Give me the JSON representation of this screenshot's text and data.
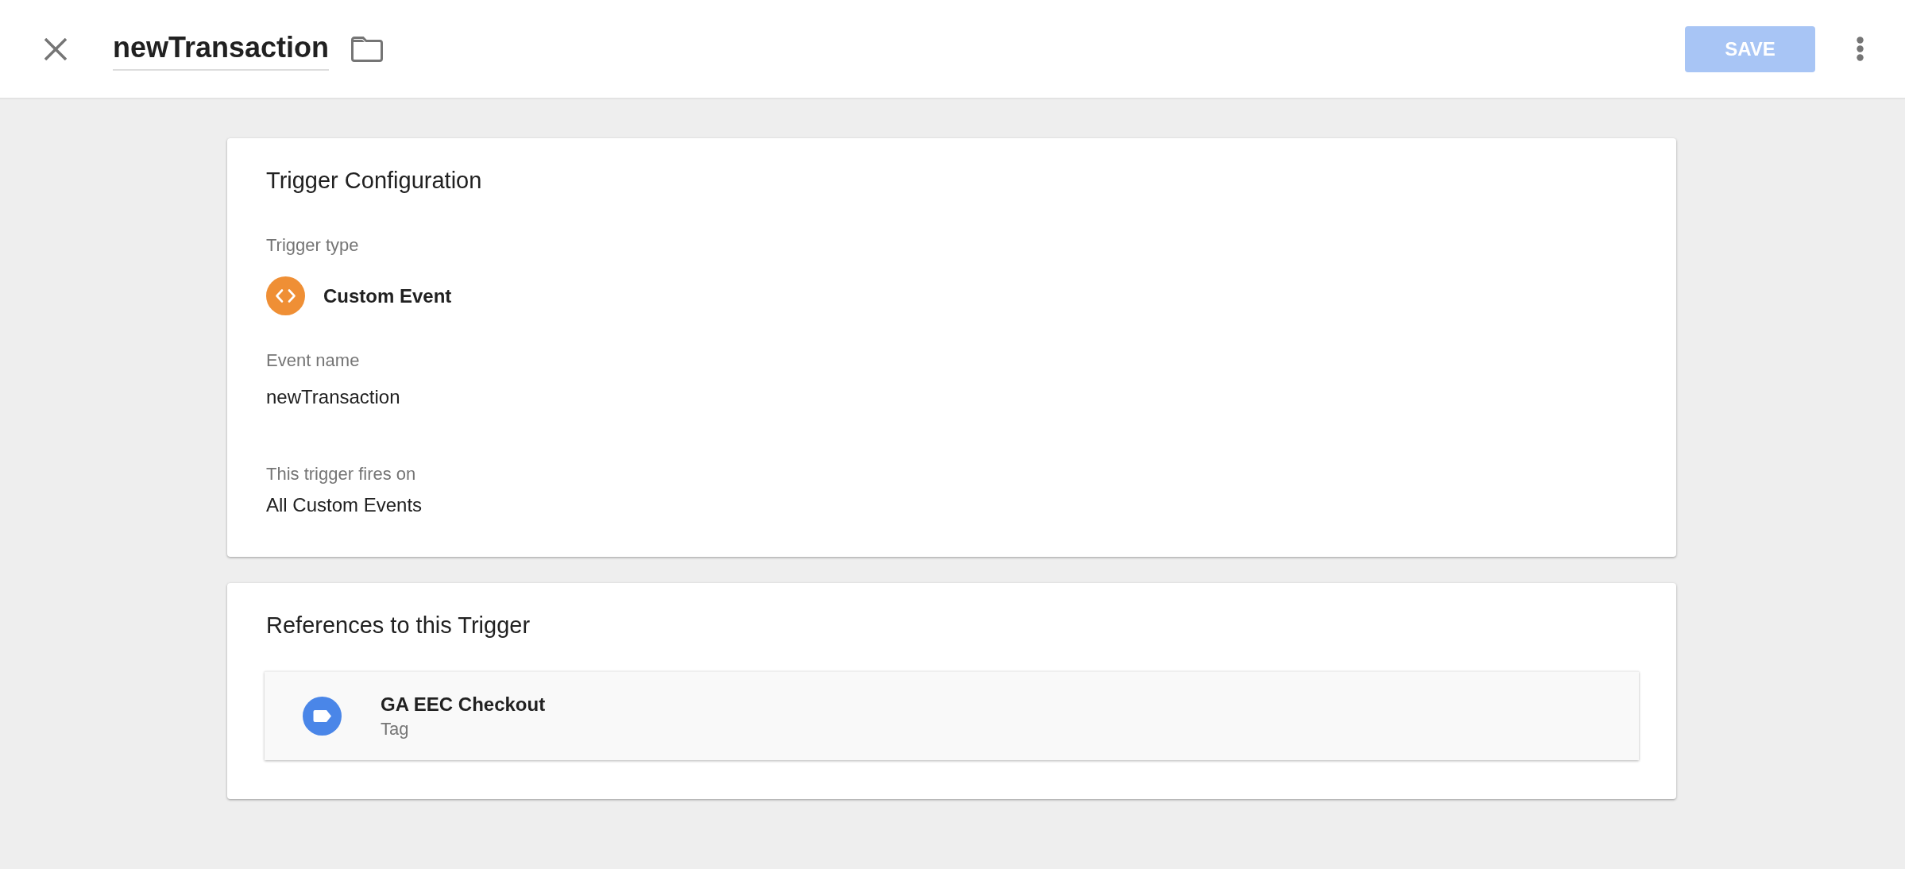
{
  "header": {
    "title": "newTransaction",
    "save_button": {
      "label": "SAVE",
      "disabled": true
    }
  },
  "trigger_configuration": {
    "title": "Trigger Configuration",
    "fields": [
      {
        "kind": "type",
        "label": "Trigger type",
        "value": "Custom Event"
      },
      {
        "kind": "text",
        "label": "Event name",
        "value": "newTransaction"
      },
      {
        "kind": "summary",
        "label": "This trigger fires on",
        "value": "All Custom Events"
      }
    ]
  },
  "references": {
    "title": "References to this Trigger",
    "items": [
      {
        "kind": "tag",
        "name": "GA EEC Checkout",
        "type": "Tag"
      }
    ]
  }
}
